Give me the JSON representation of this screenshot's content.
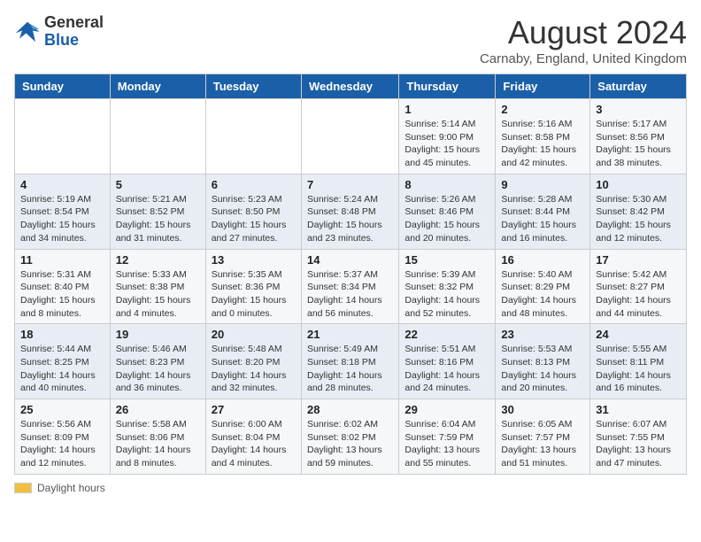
{
  "logo": {
    "general": "General",
    "blue": "Blue"
  },
  "title": "August 2024",
  "location": "Carnaby, England, United Kingdom",
  "days_of_week": [
    "Sunday",
    "Monday",
    "Tuesday",
    "Wednesday",
    "Thursday",
    "Friday",
    "Saturday"
  ],
  "legend": {
    "label": "Daylight hours"
  },
  "weeks": [
    [
      {
        "day": "",
        "info": ""
      },
      {
        "day": "",
        "info": ""
      },
      {
        "day": "",
        "info": ""
      },
      {
        "day": "",
        "info": ""
      },
      {
        "day": "1",
        "info": "Sunrise: 5:14 AM\nSunset: 9:00 PM\nDaylight: 15 hours\nand 45 minutes."
      },
      {
        "day": "2",
        "info": "Sunrise: 5:16 AM\nSunset: 8:58 PM\nDaylight: 15 hours\nand 42 minutes."
      },
      {
        "day": "3",
        "info": "Sunrise: 5:17 AM\nSunset: 8:56 PM\nDaylight: 15 hours\nand 38 minutes."
      }
    ],
    [
      {
        "day": "4",
        "info": "Sunrise: 5:19 AM\nSunset: 8:54 PM\nDaylight: 15 hours\nand 34 minutes."
      },
      {
        "day": "5",
        "info": "Sunrise: 5:21 AM\nSunset: 8:52 PM\nDaylight: 15 hours\nand 31 minutes."
      },
      {
        "day": "6",
        "info": "Sunrise: 5:23 AM\nSunset: 8:50 PM\nDaylight: 15 hours\nand 27 minutes."
      },
      {
        "day": "7",
        "info": "Sunrise: 5:24 AM\nSunset: 8:48 PM\nDaylight: 15 hours\nand 23 minutes."
      },
      {
        "day": "8",
        "info": "Sunrise: 5:26 AM\nSunset: 8:46 PM\nDaylight: 15 hours\nand 20 minutes."
      },
      {
        "day": "9",
        "info": "Sunrise: 5:28 AM\nSunset: 8:44 PM\nDaylight: 15 hours\nand 16 minutes."
      },
      {
        "day": "10",
        "info": "Sunrise: 5:30 AM\nSunset: 8:42 PM\nDaylight: 15 hours\nand 12 minutes."
      }
    ],
    [
      {
        "day": "11",
        "info": "Sunrise: 5:31 AM\nSunset: 8:40 PM\nDaylight: 15 hours\nand 8 minutes."
      },
      {
        "day": "12",
        "info": "Sunrise: 5:33 AM\nSunset: 8:38 PM\nDaylight: 15 hours\nand 4 minutes."
      },
      {
        "day": "13",
        "info": "Sunrise: 5:35 AM\nSunset: 8:36 PM\nDaylight: 15 hours\nand 0 minutes."
      },
      {
        "day": "14",
        "info": "Sunrise: 5:37 AM\nSunset: 8:34 PM\nDaylight: 14 hours\nand 56 minutes."
      },
      {
        "day": "15",
        "info": "Sunrise: 5:39 AM\nSunset: 8:32 PM\nDaylight: 14 hours\nand 52 minutes."
      },
      {
        "day": "16",
        "info": "Sunrise: 5:40 AM\nSunset: 8:29 PM\nDaylight: 14 hours\nand 48 minutes."
      },
      {
        "day": "17",
        "info": "Sunrise: 5:42 AM\nSunset: 8:27 PM\nDaylight: 14 hours\nand 44 minutes."
      }
    ],
    [
      {
        "day": "18",
        "info": "Sunrise: 5:44 AM\nSunset: 8:25 PM\nDaylight: 14 hours\nand 40 minutes."
      },
      {
        "day": "19",
        "info": "Sunrise: 5:46 AM\nSunset: 8:23 PM\nDaylight: 14 hours\nand 36 minutes."
      },
      {
        "day": "20",
        "info": "Sunrise: 5:48 AM\nSunset: 8:20 PM\nDaylight: 14 hours\nand 32 minutes."
      },
      {
        "day": "21",
        "info": "Sunrise: 5:49 AM\nSunset: 8:18 PM\nDaylight: 14 hours\nand 28 minutes."
      },
      {
        "day": "22",
        "info": "Sunrise: 5:51 AM\nSunset: 8:16 PM\nDaylight: 14 hours\nand 24 minutes."
      },
      {
        "day": "23",
        "info": "Sunrise: 5:53 AM\nSunset: 8:13 PM\nDaylight: 14 hours\nand 20 minutes."
      },
      {
        "day": "24",
        "info": "Sunrise: 5:55 AM\nSunset: 8:11 PM\nDaylight: 14 hours\nand 16 minutes."
      }
    ],
    [
      {
        "day": "25",
        "info": "Sunrise: 5:56 AM\nSunset: 8:09 PM\nDaylight: 14 hours\nand 12 minutes."
      },
      {
        "day": "26",
        "info": "Sunrise: 5:58 AM\nSunset: 8:06 PM\nDaylight: 14 hours\nand 8 minutes."
      },
      {
        "day": "27",
        "info": "Sunrise: 6:00 AM\nSunset: 8:04 PM\nDaylight: 14 hours\nand 4 minutes."
      },
      {
        "day": "28",
        "info": "Sunrise: 6:02 AM\nSunset: 8:02 PM\nDaylight: 13 hours\nand 59 minutes."
      },
      {
        "day": "29",
        "info": "Sunrise: 6:04 AM\nSunset: 7:59 PM\nDaylight: 13 hours\nand 55 minutes."
      },
      {
        "day": "30",
        "info": "Sunrise: 6:05 AM\nSunset: 7:57 PM\nDaylight: 13 hours\nand 51 minutes."
      },
      {
        "day": "31",
        "info": "Sunrise: 6:07 AM\nSunset: 7:55 PM\nDaylight: 13 hours\nand 47 minutes."
      }
    ]
  ]
}
